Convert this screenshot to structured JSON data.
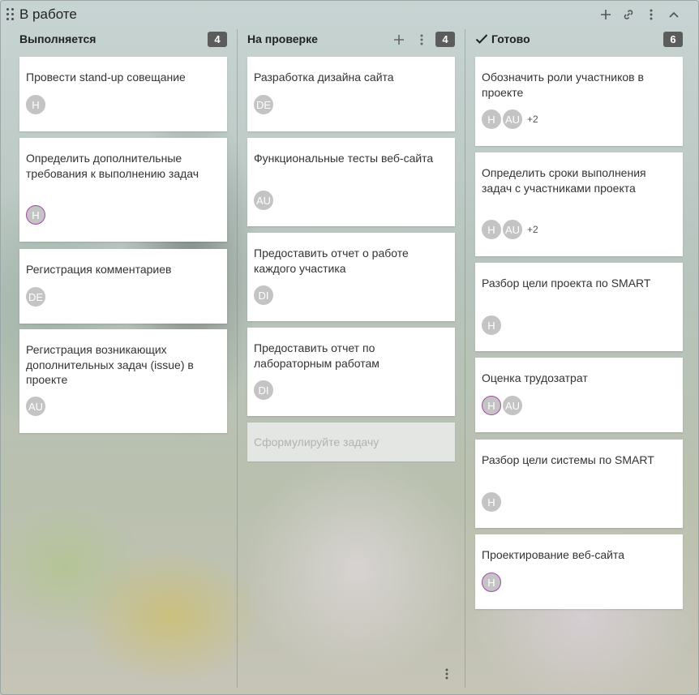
{
  "board": {
    "title": "В работе",
    "icons": [
      "drag-handle-icon",
      "plus-icon",
      "link-icon",
      "more-vertical-icon",
      "chevron-up-icon"
    ]
  },
  "columns": [
    {
      "title": "Выполняется",
      "count": "4",
      "cards": [
        {
          "title": "Провести stand-up совещание",
          "avatars": [
            "H"
          ],
          "more": ""
        },
        {
          "title": "Определить дополнительные требования к выполнению задач",
          "avatars": [
            "H"
          ],
          "more": ""
        },
        {
          "title": "Регистрация комментариев",
          "avatars": [
            "DE"
          ],
          "more": ""
        },
        {
          "title": "Регистрация возникающих дополнительных задач (issue) в проекте",
          "avatars": [
            "AU"
          ],
          "more": ""
        }
      ]
    },
    {
      "title": "На проверке",
      "count": "4",
      "cards": [
        {
          "title": "Разработка дизайна сайта",
          "avatars": [
            "DE"
          ],
          "more": ""
        },
        {
          "title": "Функциональные тесты веб-сайта",
          "avatars": [
            "AU"
          ],
          "more": ""
        },
        {
          "title": "Предоставить отчет о работе каждого участика",
          "avatars": [
            "DI"
          ],
          "more": ""
        },
        {
          "title": "Предоставить отчет по лабораторным работам",
          "avatars": [
            "DI"
          ],
          "more": ""
        }
      ],
      "new_task_placeholder": "Сформулируйте задачу"
    },
    {
      "title": "Готово",
      "count": "6",
      "cards": [
        {
          "title": "Обозначить роли участников в проекте",
          "avatars": [
            "H",
            "AU"
          ],
          "more": "+2"
        },
        {
          "title": "Определить сроки выполнения задач с участниками проекта",
          "avatars": [
            "H",
            "AU"
          ],
          "more": "+2"
        },
        {
          "title": "Разбор цели проекта по SMART",
          "avatars": [
            "H"
          ],
          "more": ""
        },
        {
          "title": "Оценка трудозатрат",
          "avatars": [
            "H",
            "AU"
          ],
          "more": ""
        },
        {
          "title": "Разбор цели системы по SMART",
          "avatars": [
            "H"
          ],
          "more": ""
        },
        {
          "title": "Проектирование веб-сайта",
          "avatars": [
            "H"
          ],
          "more": ""
        }
      ]
    }
  ],
  "colors": {
    "count_badge": "#5c5c5c",
    "avatar": "#c4c4c4",
    "avatar_ring": "#a447a8"
  }
}
